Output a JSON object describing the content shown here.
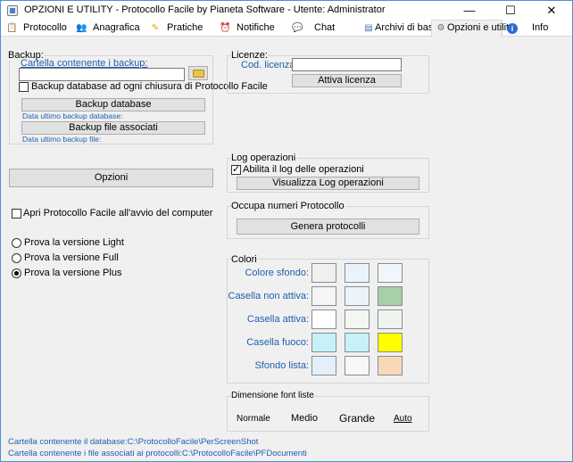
{
  "window": {
    "title": "OPZIONI E UTILITY - Protocollo Facile by Pianeta Software - Utente: Administrator",
    "minimize": "—",
    "maximize": "☐",
    "close": "✕"
  },
  "tabs": [
    {
      "label": "Protocollo",
      "icon": "clipboard-icon"
    },
    {
      "label": "Anagrafica",
      "icon": "people-icon"
    },
    {
      "label": "Pratiche",
      "icon": "pencil-icon"
    },
    {
      "label": "Notifiche",
      "icon": "alarm-icon"
    },
    {
      "label": "Chat",
      "icon": "chat-icon"
    },
    {
      "label": "Archivi di base",
      "icon": "archive-icon"
    },
    {
      "label": "Opzioni e utility",
      "icon": "gear-icon"
    },
    {
      "label": "Info",
      "icon": "info-icon"
    }
  ],
  "backup": {
    "group_label": "Backup:",
    "folder_label": "Cartella contenente i backup:",
    "folder_value": "",
    "auto_backup_label": "Backup database ad ogni chiusura di Protocollo Facile",
    "auto_backup_checked": false,
    "backup_db_button": "Backup database",
    "last_db_backup_label": "Data ultimo backup database:",
    "backup_files_button": "Backup file associati",
    "last_file_backup_label": "Data ultimo backup file:"
  },
  "options_button": "Opzioni",
  "startup": {
    "label": "Apri Protocollo Facile all'avvio del computer",
    "checked": false
  },
  "versions": [
    {
      "label": "Prova la versione Light",
      "selected": false
    },
    {
      "label": "Prova la versione Full",
      "selected": false
    },
    {
      "label": "Prova la versione Plus",
      "selected": true
    }
  ],
  "license": {
    "group_label": "Licenze:",
    "code_label": "Cod. licenza:",
    "code_value": "",
    "activate_button": "Attiva licenza"
  },
  "log": {
    "group_label": "Log operazioni",
    "enable_label": "Abilita il log delle operazioni",
    "enable_checked": true,
    "view_button": "Visualizza Log operazioni"
  },
  "protocol_numbers": {
    "group_label": "Occupa numeri Protocollo",
    "generate_button": "Genera protocolli"
  },
  "colors": {
    "group_label": "Colori",
    "rows": [
      {
        "label": "Colore sfondo:",
        "swatches": [
          "#f0f0f0",
          "#eaf3fb",
          "#f0f6fb"
        ]
      },
      {
        "label": "Casella non attiva:",
        "swatches": [
          "#f5f5f5",
          "#ecf4fb",
          "#a9cfa9"
        ]
      },
      {
        "label": "Casella attiva:",
        "swatches": [
          "#ffffff",
          "#f2f7f2",
          "#eef5ee"
        ]
      },
      {
        "label": "Casella fuoco:",
        "swatches": [
          "#c6f1f8",
          "#c6f1f8",
          "#ffff00"
        ]
      },
      {
        "label": "Sfondo lista:",
        "swatches": [
          "#e3f0fb",
          "#f7f7f7",
          "#f9d8b8"
        ]
      }
    ]
  },
  "font_size": {
    "group_label": "Dimensione font liste",
    "options": [
      "Normale",
      "Medio",
      "Grande",
      "Auto"
    ]
  },
  "status": {
    "db_folder": "Cartella contenente il database:C:\\ProtocolloFacile\\PerScreenShot",
    "files_folder": "Cartella contenente i file associati ai protocolli:C:\\ProtocolloFacile\\PFDocumenti"
  }
}
